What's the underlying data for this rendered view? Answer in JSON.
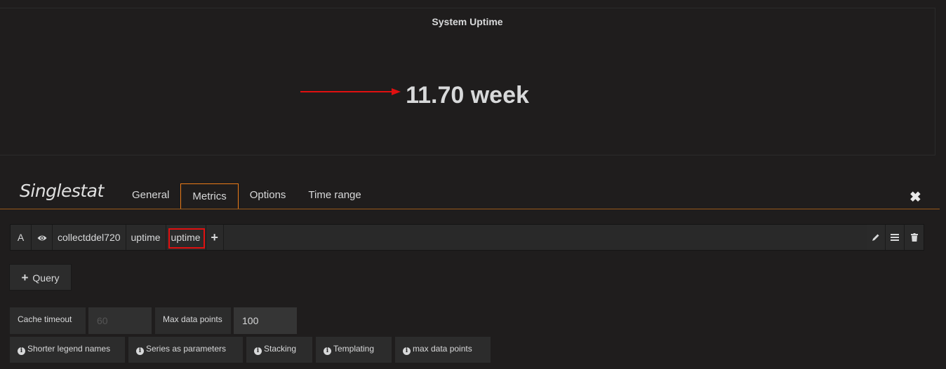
{
  "panel": {
    "title": "System Uptime",
    "stat_value": "11.70 week",
    "arrow_color": "#e01010"
  },
  "editor": {
    "title": "Singlestat",
    "tabs": [
      "General",
      "Metrics",
      "Options",
      "Time range"
    ],
    "active_tab": "Metrics",
    "close_icon": "close-icon"
  },
  "query": {
    "ref_id": "A",
    "eye_icon": "eye-icon",
    "host": "collectddel720",
    "plugin": "uptime",
    "type": "uptime",
    "highlight_color": "#e01010",
    "add_icon": "plus-icon",
    "actions": [
      "pencil-icon",
      "menu-icon",
      "trash-icon"
    ]
  },
  "buttons": {
    "add_query": "Query"
  },
  "options": {
    "cache_timeout_label": "Cache timeout",
    "cache_timeout_placeholder": "60",
    "max_data_points_label": "Max data points",
    "max_data_points_value": "100"
  },
  "help": [
    "Shorter legend names",
    "Series as parameters",
    "Stacking",
    "Templating",
    "max data points"
  ],
  "accent_color": "#eb7b18"
}
